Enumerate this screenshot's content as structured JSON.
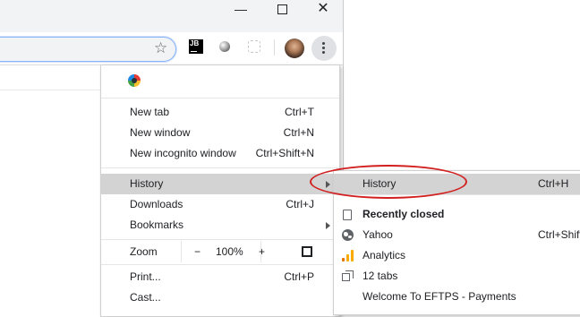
{
  "window_controls": {
    "minimize": "—",
    "close": "✕"
  },
  "toolbar": {
    "bookmark_icon": "star-icon",
    "extension_jb_label": "JB",
    "menu_icon": "three-dots-vertical-icon"
  },
  "menu": {
    "app_icon": "colorful-ring-icon",
    "new_tab": {
      "label": "New tab",
      "shortcut": "Ctrl+T"
    },
    "new_window": {
      "label": "New window",
      "shortcut": "Ctrl+N"
    },
    "new_incognito": {
      "label": "New incognito window",
      "shortcut": "Ctrl+Shift+N"
    },
    "history": {
      "label": "History"
    },
    "downloads": {
      "label": "Downloads",
      "shortcut": "Ctrl+J"
    },
    "bookmarks": {
      "label": "Bookmarks"
    },
    "zoom": {
      "label": "Zoom",
      "minus": "−",
      "value": "100%",
      "plus": "+"
    },
    "print": {
      "label": "Print...",
      "shortcut": "Ctrl+P"
    },
    "cast": {
      "label": "Cast..."
    }
  },
  "history_submenu": {
    "history": {
      "label": "History",
      "shortcut": "Ctrl+H"
    },
    "recently_closed": {
      "label": "Recently closed"
    },
    "entries": [
      {
        "label": "Yahoo",
        "shortcut": "Ctrl+Shift+T",
        "icon": "globe-icon"
      },
      {
        "label": "Analytics",
        "icon": "analytics-icon"
      },
      {
        "label": "12 tabs",
        "icon": "tabs-icon"
      },
      {
        "label": "Welcome To EFTPS - Payments"
      }
    ]
  },
  "annotation": {
    "color": "#d21f1f",
    "shape": "ellipse-around-history"
  },
  "colors": {
    "highlight": "#d3d3d3",
    "toolbar_bg": "#f1f3f4",
    "menu_border": "#d0d0d0"
  }
}
